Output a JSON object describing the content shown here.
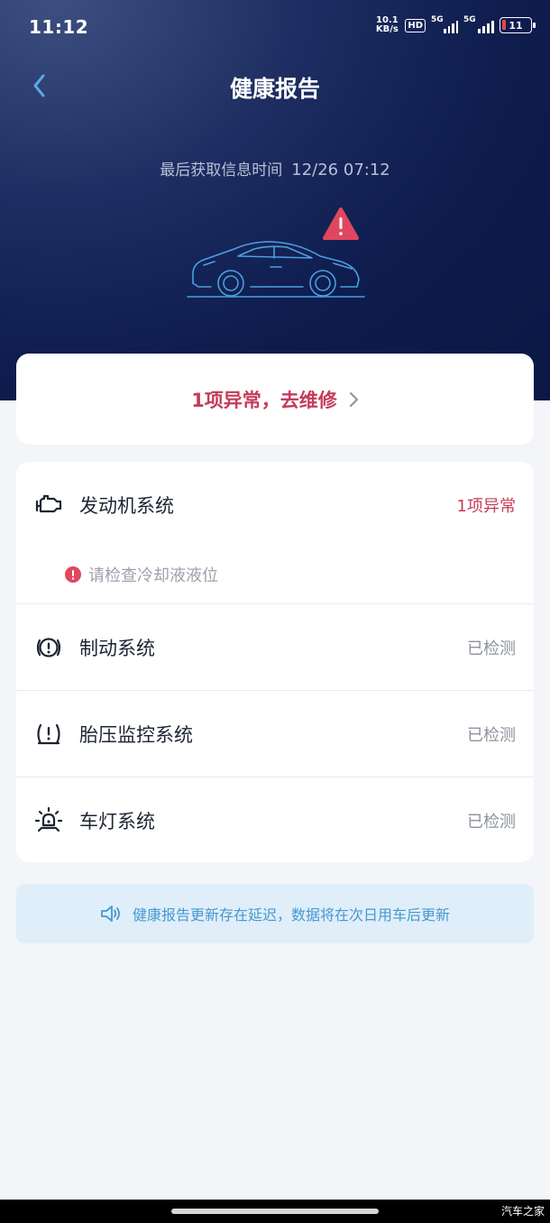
{
  "status_bar": {
    "time": "11:12",
    "net_speed_value": "10.1",
    "net_speed_unit": "KB/s",
    "hd_badge": "HD",
    "sim1_label": "5G",
    "sim2_label": "5G",
    "battery_level": "11"
  },
  "header": {
    "title": "健康报告",
    "last_fetch_label": "最后获取信息时间",
    "last_fetch_time": "12/26 07:12"
  },
  "repair": {
    "label": "1项异常，去维修"
  },
  "systems": [
    {
      "name": "发动机系统",
      "status": "1项异常",
      "icon": "engine-icon",
      "warning": "请检查冷却液液位"
    },
    {
      "name": "制动系统",
      "status": "已检测",
      "icon": "brake-icon"
    },
    {
      "name": "胎压监控系统",
      "status": "已检测",
      "icon": "tire-pressure-icon"
    },
    {
      "name": "车灯系统",
      "status": "已检测",
      "icon": "lamp-icon"
    }
  ],
  "notice": {
    "text": "健康报告更新存在延迟，数据将在次日用车后更新",
    "icon": "speaker-icon"
  },
  "watermark": "汽车之家",
  "colors": {
    "alert": "#c53c59",
    "hero_bg": "#0e1c4e",
    "notice_bg": "#dfeef9",
    "notice_text": "#4598d0",
    "car_outline": "#4a9fe0"
  }
}
